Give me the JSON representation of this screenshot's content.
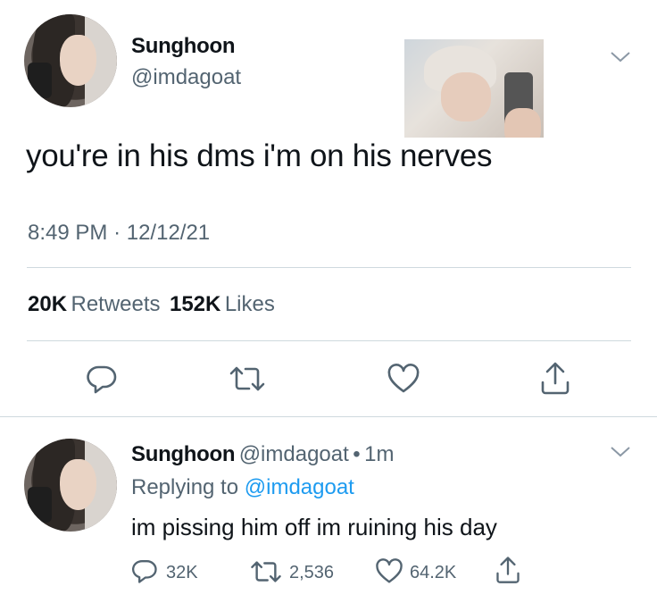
{
  "main_tweet": {
    "author_name": "Sunghoon",
    "author_handle": "@imdagoat",
    "text": "you're in his dms i'm on his nerves",
    "time": "8:49 PM",
    "separator": "·",
    "date": "12/12/21",
    "retweets_count": "20K",
    "retweets_label": "Retweets",
    "likes_count": "152K",
    "likes_label": "Likes"
  },
  "reply": {
    "author_name": "Sunghoon",
    "author_handle": "@imdagoat",
    "dot": "•",
    "time_ago": "1m",
    "replying_prefix": "Replying to",
    "replying_handle": "@imdagoat",
    "text": "im pissing him off im ruining his day",
    "reply_count": "32K",
    "retweet_count": "2,536",
    "like_count": "64.2K"
  },
  "icons": {
    "reply": "reply-icon",
    "retweet": "retweet-icon",
    "like": "heart-icon",
    "share": "share-icon",
    "more": "chevron-down-icon"
  },
  "colors": {
    "text": "#0f1419",
    "secondary": "#536471",
    "link": "#1d9bf0",
    "divider": "#cfd9de"
  }
}
